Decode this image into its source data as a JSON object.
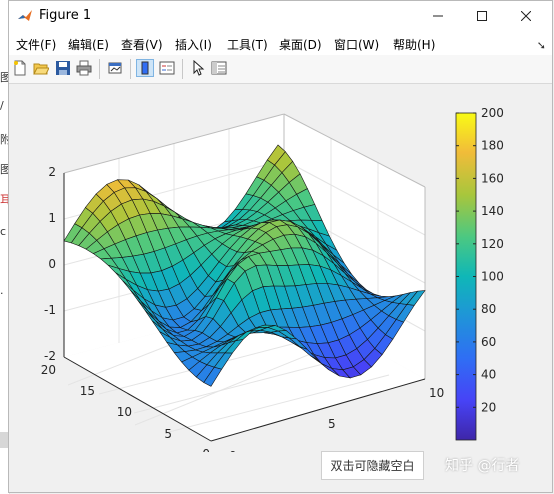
{
  "window": {
    "title": "Figure 1"
  },
  "menu": [
    {
      "label": "文件(F)"
    },
    {
      "label": "编辑(E)"
    },
    {
      "label": "查看(V)"
    },
    {
      "label": "插入(I)"
    },
    {
      "label": "工具(T)"
    },
    {
      "label": "桌面(D)"
    },
    {
      "label": "窗口(W)"
    },
    {
      "label": "帮助(H)"
    }
  ],
  "toolbar": {
    "buttons": [
      {
        "icon": "new-figure-icon"
      },
      {
        "icon": "open-file-icon"
      },
      {
        "icon": "save-icon"
      },
      {
        "icon": "print-icon"
      },
      {
        "icon": "link-plot-icon"
      },
      {
        "icon": "insert-colorbar-icon",
        "active": true
      },
      {
        "icon": "insert-legend-icon"
      },
      {
        "icon": "pointer-icon"
      },
      {
        "icon": "property-editor-icon"
      }
    ]
  },
  "background_glyphs": [
    "图",
    "/",
    "附",
    "图",
    "耳",
    "c",
    "·"
  ],
  "axes": {
    "z_ticks": [
      "2",
      "1",
      "0",
      "-1",
      "-2"
    ],
    "y_ticks": [
      "20",
      "15",
      "10",
      "5",
      "0"
    ],
    "x_ticks": [
      "0",
      "5",
      "10"
    ]
  },
  "colorbar": {
    "ticks": [
      "200",
      "180",
      "160",
      "140",
      "120",
      "100",
      "80",
      "60",
      "40",
      "20"
    ],
    "colors": [
      "#3e26a8",
      "#4743f6",
      "#2f6ef4",
      "#1f95d8",
      "#0fb7b7",
      "#4bc882",
      "#a8c63c",
      "#f1bc39",
      "#f9fb15"
    ]
  },
  "hint_button": "双击可隐藏空白",
  "watermark": "知乎 @行者"
}
